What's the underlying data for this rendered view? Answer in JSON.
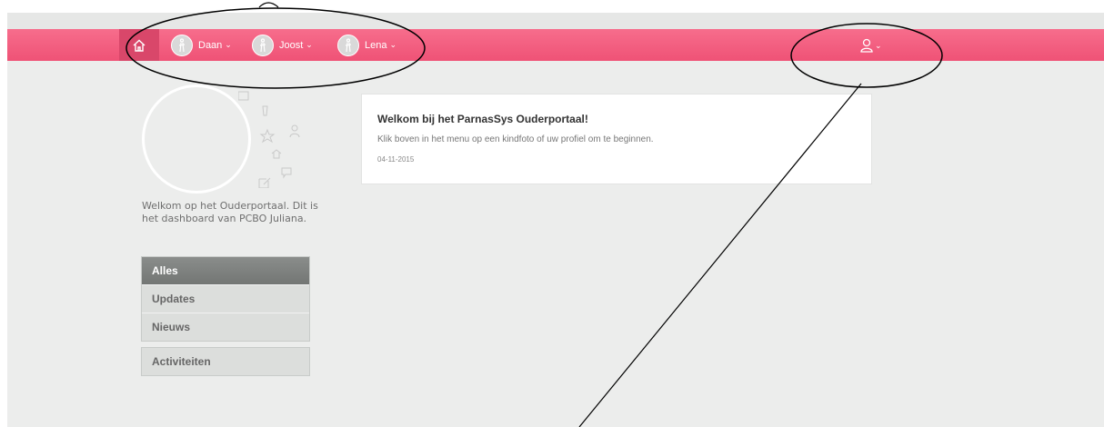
{
  "nav": {
    "home_icon": "home-icon",
    "children": [
      {
        "name": "Daan"
      },
      {
        "name": "Joost"
      },
      {
        "name": "Lena"
      }
    ],
    "profile_icon": "user-icon",
    "accent": "#ef5276"
  },
  "sidebar": {
    "welcome": "Welkom op het Ouderportaal. Dit is het dashboard van PCBO Juliana.",
    "menu": [
      {
        "label": "Alles",
        "active": true
      },
      {
        "label": "Updates",
        "active": false
      },
      {
        "label": "Nieuws",
        "active": false
      }
    ],
    "menu2": [
      {
        "label": "Activiteiten"
      }
    ]
  },
  "card": {
    "title": "Welkom bij het ParnasSys Ouderportaal!",
    "subtitle": "Klik boven in het menu op een kindfoto of uw profiel om te beginnen.",
    "date": "04-11-2015"
  }
}
